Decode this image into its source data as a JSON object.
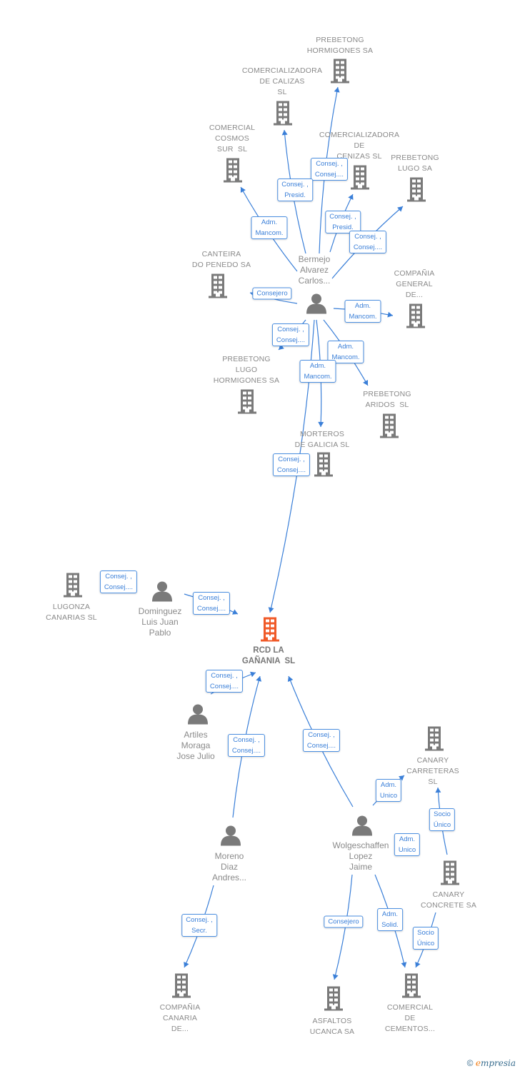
{
  "colors": {
    "edge": "#3a7fd8",
    "node": "#7a7a7a",
    "focus": "#f05a28"
  },
  "nodes": [
    {
      "label": "PREBETONG\nHORMIGONES SA",
      "type": "company"
    },
    {
      "label": "COMERCIALIZADORA\nDE CALIZAS\nSL",
      "type": "company"
    },
    {
      "label": "COMERCIAL\nCOSMOS\nSUR  SL",
      "type": "company"
    },
    {
      "label": "COMERCIALIZADORA\nDE\nCENIZAS SL",
      "type": "company"
    },
    {
      "label": "PREBETONG\nLUGO SA",
      "type": "company"
    },
    {
      "label": "CANTEIRA\nDO PENEDO SA",
      "type": "company"
    },
    {
      "label": "Bermejo\nAlvarez\nCarlos...",
      "type": "person"
    },
    {
      "label": "COMPAÑIA\nGENERAL\nDE...",
      "type": "company"
    },
    {
      "label": "PREBETONG\nLUGO\nHORMIGONES SA",
      "type": "company"
    },
    {
      "label": "PREBETONG\nARIDOS  SL",
      "type": "company"
    },
    {
      "label": "MORTEROS\nDE GALICIA SL",
      "type": "company"
    },
    {
      "label": "LUGONZA\nCANARIAS SL",
      "type": "company"
    },
    {
      "label": "Dominguez\nLuis Juan\nPablo",
      "type": "person"
    },
    {
      "label": "RCD LA\nGAÑANIA  SL",
      "type": "main"
    },
    {
      "label": "Artiles\nMoraga\nJose Julio",
      "type": "person"
    },
    {
      "label": "CANARY\nCARRETERAS\nSL",
      "type": "company"
    },
    {
      "label": "Moreno\nDiaz\nAndres...",
      "type": "person"
    },
    {
      "label": "Wolgeschaffen\nLopez\nJaime",
      "type": "person"
    },
    {
      "label": "CANARY\nCONCRETE SA",
      "type": "company"
    },
    {
      "label": "COMPAÑIA\nCANARIA\nDE...",
      "type": "company"
    },
    {
      "label": "ASFALTOS\nUCANCA SA",
      "type": "company"
    },
    {
      "label": "COMERCIAL\nDE\nCEMENTOS...",
      "type": "company"
    }
  ],
  "edges": [
    {
      "from": 6,
      "to": 0,
      "label": "Consej. ,\nConsej...."
    },
    {
      "from": 6,
      "to": 1,
      "label": "Consej. ,\nPresid."
    },
    {
      "from": 6,
      "to": 2,
      "label": "Adm.\nMancom."
    },
    {
      "from": 6,
      "to": 3,
      "label": "Consej. ,\nPresid."
    },
    {
      "from": 6,
      "to": 4,
      "label": "Consej. ,\nConsej...."
    },
    {
      "from": 6,
      "to": 5,
      "label": "Consejero"
    },
    {
      "from": 6,
      "to": 7,
      "label": "Adm.\nMancom."
    },
    {
      "from": 6,
      "to": 8,
      "label": "Consej. ,\nConsej...."
    },
    {
      "from": 6,
      "to": 9,
      "label": "Adm.\nMancom."
    },
    {
      "from": 6,
      "to": 10,
      "label": "Adm.\nMancom."
    },
    {
      "from": 6,
      "to": 13,
      "label": "Consej. ,\nConsej...."
    },
    {
      "from": 11,
      "to": 12,
      "label": "Consej. ,\nConsej...."
    },
    {
      "from": 12,
      "to": 13,
      "label": "Consej. ,\nConsej...."
    },
    {
      "from": 14,
      "to": 13,
      "label": "Consej. ,\nConsej...."
    },
    {
      "from": 16,
      "to": 13,
      "label": "Consej. ,\nConsej...."
    },
    {
      "from": 17,
      "to": 13,
      "label": "Consej. ,\nConsej...."
    },
    {
      "from": 17,
      "to": 15,
      "label": "Adm.\nUnico"
    },
    {
      "from": 17,
      "to": 18,
      "label": "Adm.\nUnico"
    },
    {
      "from": 18,
      "to": 15,
      "label": "Socio\nÚnico"
    },
    {
      "from": 16,
      "to": 19,
      "label": "Consej. ,\nSecr."
    },
    {
      "from": 17,
      "to": 20,
      "label": "Consejero"
    },
    {
      "from": 17,
      "to": 21,
      "label": "Adm.\nSolid."
    },
    {
      "from": 18,
      "to": 21,
      "label": "Socio\nÚnico"
    }
  ],
  "footer": {
    "copyright": "©",
    "brand_first": "e",
    "brand_rest": "mpresia"
  }
}
